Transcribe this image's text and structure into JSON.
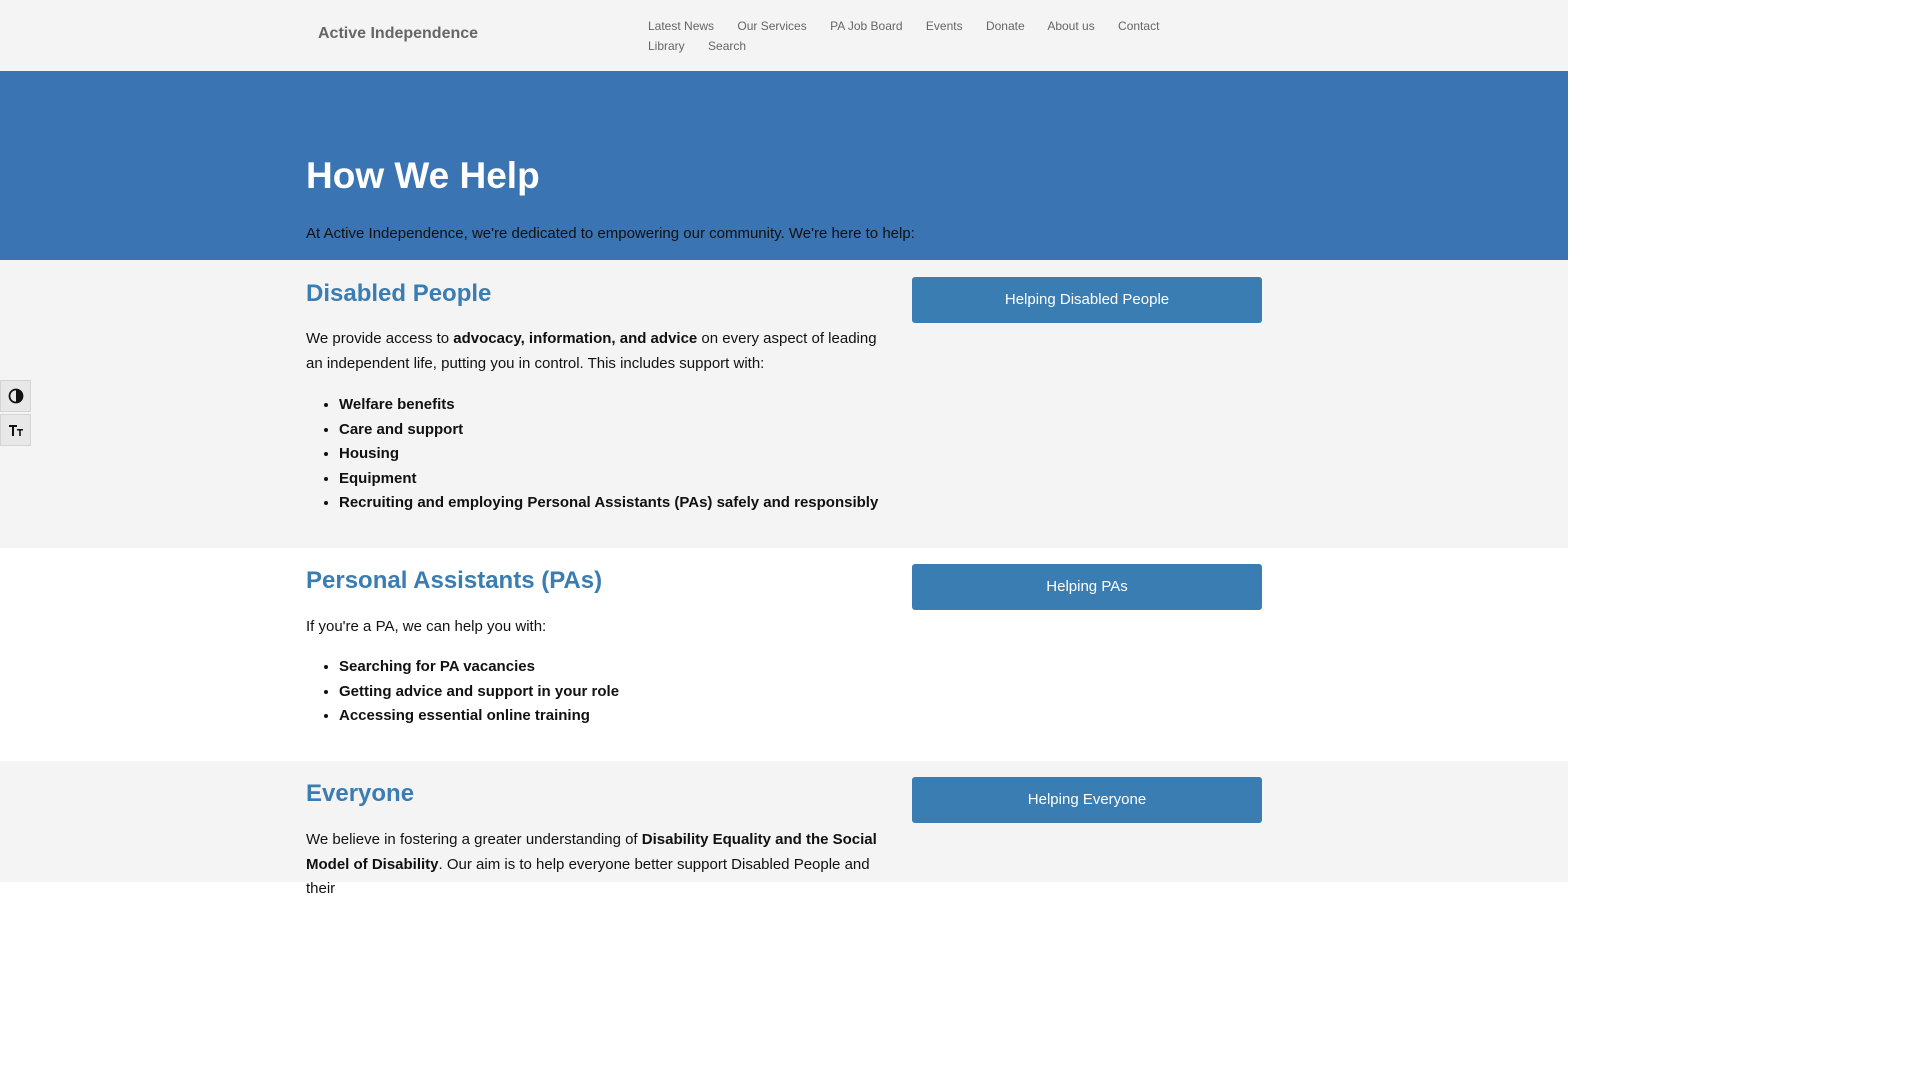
{
  "header": {
    "site_title": "Active Independence",
    "nav": [
      {
        "label": "Latest News"
      },
      {
        "label": "Our Services"
      },
      {
        "label": "PA Job Board"
      },
      {
        "label": "Events"
      },
      {
        "label": "Donate"
      },
      {
        "label": "About us"
      },
      {
        "label": "Contact"
      },
      {
        "label": "Library"
      },
      {
        "label": "Search"
      }
    ]
  },
  "hero": {
    "title": "How We Help",
    "intro": "At Active Independence, we're dedicated to empowering our community. We're here to help:"
  },
  "sections": [
    {
      "heading": "Disabled People",
      "text_before": "We provide access to ",
      "text_bold": "advocacy, information, and advice",
      "text_after": " on every aspect of leading an independent life, putting you in control. This includes support with:",
      "items": [
        "Welfare benefits",
        "Care and support",
        "Housing",
        "Equipment",
        "Recruiting and employing Personal Assistants (PAs) safely and responsibly"
      ],
      "button": "Helping Disabled People"
    },
    {
      "heading": "Personal Assistants (PAs)",
      "text": "If you're a PA, we can help you with:",
      "items": [
        "Searching for PA vacancies",
        "Getting advice and support in your role",
        "Accessing essential online training"
      ],
      "button": "Helping PAs"
    },
    {
      "heading": "Everyone",
      "text_before": "We believe in fostering a greater understanding of ",
      "text_bold": "Disability Equality and the Social Model of Disability",
      "text_after": ". Our aim is to help everyone better support Disabled People and their",
      "button": "Helping Everyone"
    }
  ],
  "accessibility_toolbar": {
    "contrast_icon": "contrast-icon",
    "text_size_icon": "text-size-icon"
  },
  "colors": {
    "header_bg": "#f4f4f4",
    "hero_bg": "#3a74b3",
    "accent": "#3a7db3",
    "section_grey": "#f4f4f4",
    "section_white": "#ffffff"
  }
}
